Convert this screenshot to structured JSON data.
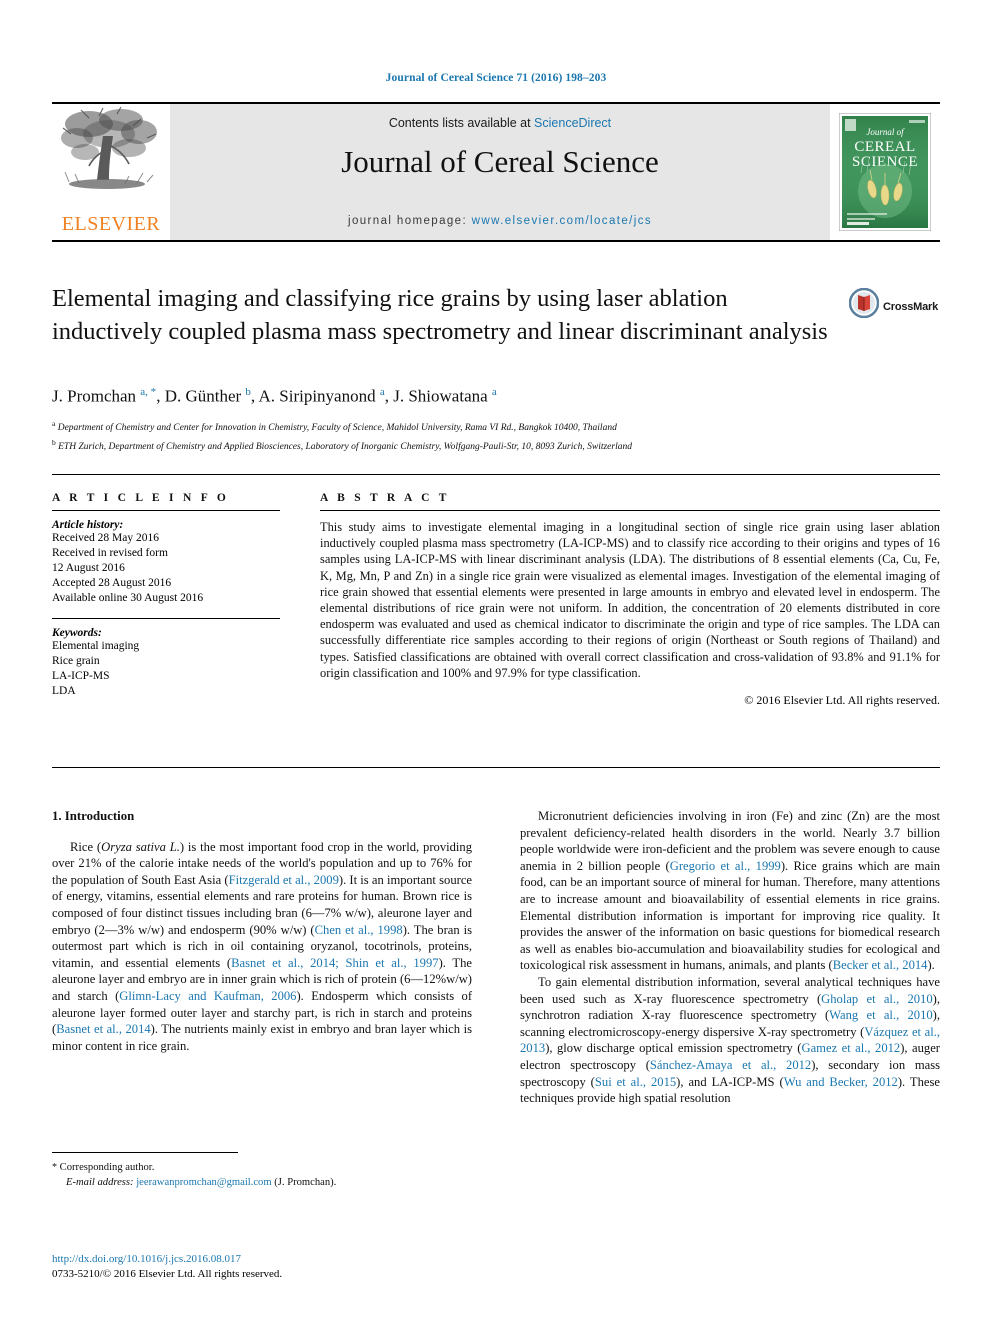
{
  "running_head": "Journal of Cereal Science 71 (2016) 198–203",
  "masthead": {
    "publisher": "ELSEVIER",
    "contents_prefix": "Contents lists available at ",
    "contents_link": "ScienceDirect",
    "journal_title": "Journal of Cereal Science",
    "homepage_prefix": "journal homepage: ",
    "homepage_link": "www.elsevier.com/locate/jcs",
    "cover": {
      "line1": "Journal of",
      "line2": "CEREAL",
      "line3": "SCIENCE"
    }
  },
  "article": {
    "title": "Elemental imaging and classifying rice grains by using laser ablation inductively coupled plasma mass spectrometry and linear discriminant analysis",
    "crossmark_label": "CrossMark",
    "authors_html": "J. Promchan <sup>a, *</sup>, D. Günther <sup>b</sup>, A. Siripinyanond <sup>a</sup>, J. Shiowatana <sup>a</sup>",
    "affiliations": [
      "Department of Chemistry and Center for Innovation in Chemistry, Faculty of Science, Mahidol University, Rama VI Rd., Bangkok 10400, Thailand",
      "ETH Zurich, Department of Chemistry and Applied Biosciences, Laboratory of Inorganic Chemistry, Wolfgang-Pauli-Str, 10, 8093 Zurich, Switzerland"
    ],
    "affiliation_marks": [
      "a",
      "b"
    ]
  },
  "info": {
    "heading": "A R T I C L E   I N F O",
    "history_label": "Article history:",
    "history": [
      "Received 28 May 2016",
      "Received in revised form",
      "12 August 2016",
      "Accepted 28 August 2016",
      "Available online 30 August 2016"
    ],
    "keywords_label": "Keywords:",
    "keywords": [
      "Elemental imaging",
      "Rice grain",
      "LA-ICP-MS",
      "LDA"
    ]
  },
  "abstract": {
    "heading": "A B S T R A C T",
    "text": "This study aims to investigate elemental imaging in a longitudinal section of single rice grain using laser ablation inductively coupled plasma mass spectrometry (LA-ICP-MS) and to classify rice according to their origins and types of 16 samples using LA-ICP-MS with linear discriminant analysis (LDA). The distributions of 8 essential elements (Ca, Cu, Fe, K, Mg, Mn, P and Zn) in a single rice grain were visualized as elemental images. Investigation of the elemental imaging of rice grain showed that essential elements were presented in large amounts in embryo and elevated level in endosperm. The elemental distributions of rice grain were not uniform. In addition, the concentration of 20 elements distributed in core endosperm was evaluated and used as chemical indicator to discriminate the origin and type of rice samples. The LDA can successfully differentiate rice samples according to their regions of origin (Northeast or South regions of Thailand) and types. Satisfied classifications are obtained with overall correct classification and cross-validation of 93.8% and 91.1% for origin classification and 100% and 97.9% for type classification.",
    "copyright": "© 2016 Elsevier Ltd. All rights reserved."
  },
  "body": {
    "section_heading": "1. Introduction",
    "left_paragraph_html": "Rice (<i>Oryza sativa L.</i>) is the most important food crop in the world, providing over 21% of the calorie intake needs of the world's population and up to 76% for the population of South East Asia (<span class=\"link\">Fitzgerald et al., 2009</span>). It is an important source of energy, vitamins, essential elements and rare proteins for human. Brown rice is composed of four distinct tissues including bran (6—7% w/w), aleurone layer and embryo (2—3% w/w) and endosperm (90% w/w) (<span class=\"link\">Chen et al., 1998</span>). The bran is outermost part which is rich in oil containing oryzanol, tocotrinols, proteins, vitamin, and essential elements (<span class=\"link\">Basnet et al., 2014; Shin et al., 1997</span>). The aleurone layer and embryo are in inner grain which is rich of protein (6—12%w/w) and starch (<span class=\"link\">Glimn-Lacy and Kaufman, 2006</span>). Endosperm which consists of aleurone layer formed outer layer and starchy part, is rich in starch and proteins (<span class=\"link\">Basnet et al., 2014</span>). The nutrients mainly exist in embryo and bran layer which is minor content in rice grain.",
    "right_paragraph_1_html": "Micronutrient deficiencies involving in iron (Fe) and zinc (Zn) are the most prevalent deficiency-related health disorders in the world. Nearly 3.7 billion people worldwide were iron-deficient and the problem was severe enough to cause anemia in 2 billion people (<span class=\"link\">Gregorio et al., 1999</span>). Rice grains which are main food, can be an important source of mineral for human. Therefore, many attentions are to increase amount and bioavailability of essential elements in rice grains. Elemental distribution information is important for improving rice quality. It provides the answer of the information on basic questions for biomedical research as well as enables bio-accumulation and bioavailability studies for ecological and toxicological risk assessment in humans, animals, and plants (<span class=\"link\">Becker et al., 2014</span>).",
    "right_paragraph_2_html": "To gain elemental distribution information, several analytical techniques have been used such as X-ray fluorescence spectrometry (<span class=\"link\">Gholap et al., 2010</span>), synchrotron radiation X-ray fluorescence spectrometry (<span class=\"link\">Wang et al., 2010</span>), scanning electromicroscopy-energy dispersive X-ray spectrometry (<span class=\"link\">Vázquez et al., 2013</span>), glow discharge optical emission spectrometry (<span class=\"link\">Gamez et al., 2012</span>), auger electron spectroscopy (<span class=\"link\">Sánchez-Amaya et al., 2012</span>), secondary ion mass spectroscopy (<span class=\"link\">Sui et al., 2015</span>), and LA-ICP-MS (<span class=\"link\">Wu and Becker, 2012</span>). These techniques provide high spatial resolution"
  },
  "footer": {
    "corresponding_author": "Corresponding author.",
    "email_label": "E-mail address:",
    "email": "jeerawanpromchan@gmail.com",
    "email_owner": "(J. Promchan).",
    "doi": "http://dx.doi.org/10.1016/j.jcs.2016.08.017",
    "issn_line": "0733-5210/© 2016 Elsevier Ltd. All rights reserved."
  },
  "colors": {
    "link": "#1b77af",
    "elsevier_orange": "#f08122",
    "band_gray": "#e6e6e6",
    "cover_green": "#2f8a4f"
  }
}
